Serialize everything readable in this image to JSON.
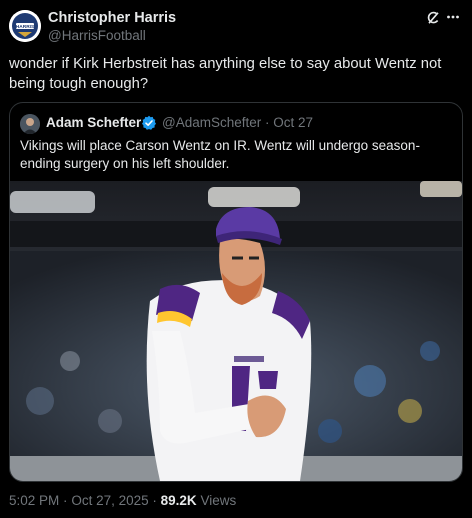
{
  "author": {
    "name": "Christopher Harris",
    "handle": "@HarrisFootball",
    "avatar_text": "HARRIS"
  },
  "tweet": {
    "text": "wonder if Kirk Herbstreit has anything else to say about Wentz not being tough enough?"
  },
  "quoted": {
    "name": "Adam Schefter",
    "handle": "@AdamSchefter",
    "separator": "·",
    "date": "Oct 27",
    "text": "Vikings will place Carson Wentz on IR. Wentz will undergo season-ending surgery on his left shoulder.",
    "media_icon": "photo"
  },
  "footer": {
    "time": "5:02 PM",
    "sep1": "·",
    "date": "Oct 27, 2025",
    "sep2": "·",
    "views_count": "89.2K",
    "views_label": "Views"
  },
  "colors": {
    "background": "#000000",
    "text": "#e7e9ea",
    "secondary": "#71767b",
    "verified": "#1d9bf0",
    "border": "#2f3336"
  },
  "icons": [
    "grok-icon",
    "more-icon",
    "verified-icon"
  ]
}
